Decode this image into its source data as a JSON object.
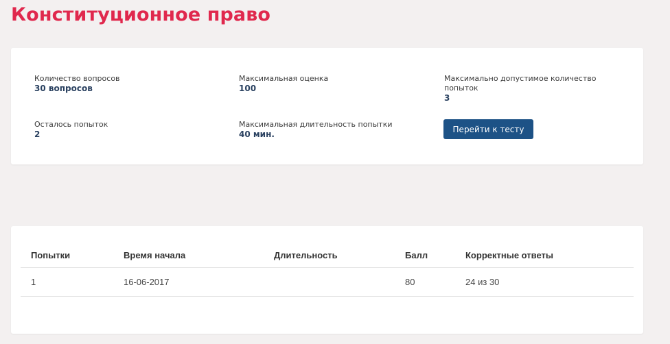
{
  "page": {
    "title": "Конституционное право"
  },
  "info": {
    "questions_label": "Количество вопросов",
    "questions_value": "30 вопросов",
    "max_score_label": "Максимальная оценка",
    "max_score_value": "100",
    "max_attempts_label": "Максимально допустимое количество попыток",
    "max_attempts_value": "3",
    "remaining_label": "Осталось попыток",
    "remaining_value": "2",
    "max_duration_label": "Максимальная длительность попытки",
    "max_duration_value": "40 мин.",
    "go_button_label": "Перейти к тесту"
  },
  "table": {
    "headers": [
      "Попытки",
      "Время начала",
      "Длительность",
      "Балл",
      "Корректные ответы"
    ],
    "rows": [
      [
        "1",
        "16-06-2017",
        "",
        "80",
        "24 из 30"
      ]
    ]
  },
  "colors": {
    "title": "#e0284d",
    "button": "#1d5286",
    "value_text": "#2a4160",
    "background": "#f3f0f0"
  }
}
